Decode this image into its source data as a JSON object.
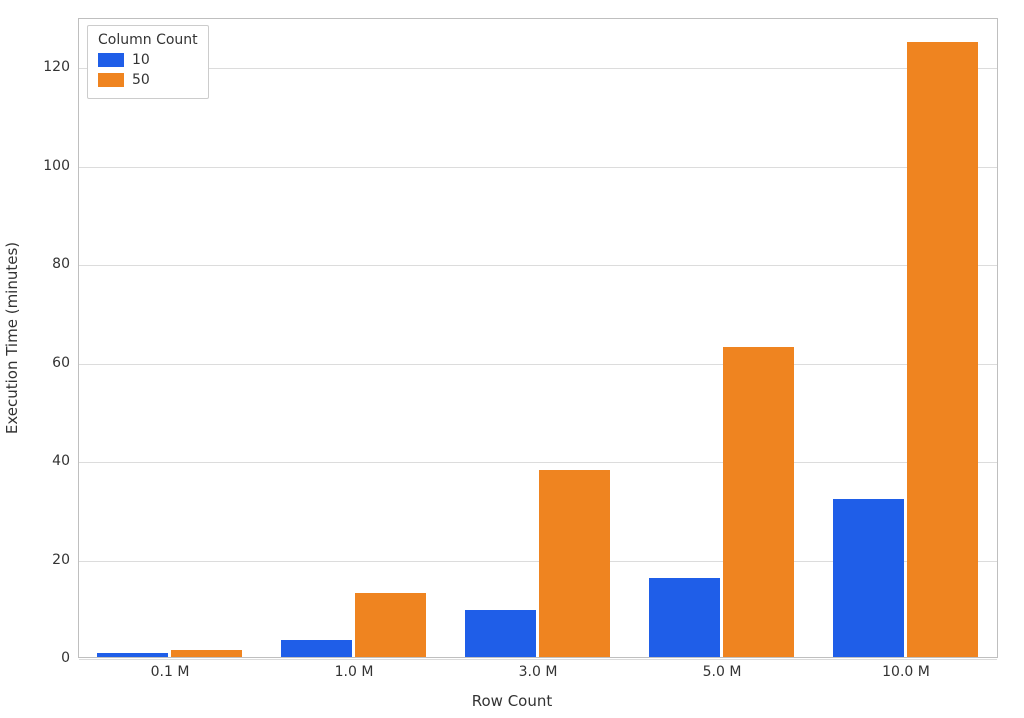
{
  "chart_data": {
    "type": "bar",
    "categories": [
      "0.1 M",
      "1.0 M",
      "3.0 M",
      "5.0 M",
      "10.0 M"
    ],
    "series": [
      {
        "name": "10",
        "values": [
          0.8,
          3.5,
          9.5,
          16,
          32
        ]
      },
      {
        "name": "50",
        "values": [
          1.5,
          13,
          38,
          63,
          125
        ]
      }
    ],
    "xlabel": "Row Count",
    "ylabel": "Execution Time (minutes)",
    "ylim": [
      0,
      130
    ],
    "yticks": [
      0,
      20,
      40,
      60,
      80,
      100,
      120
    ],
    "legend_title": "Column Count",
    "colors": {
      "10": "#1f5ee8",
      "50": "#ef8420"
    },
    "legend_position": "upper-left",
    "grid": true
  }
}
